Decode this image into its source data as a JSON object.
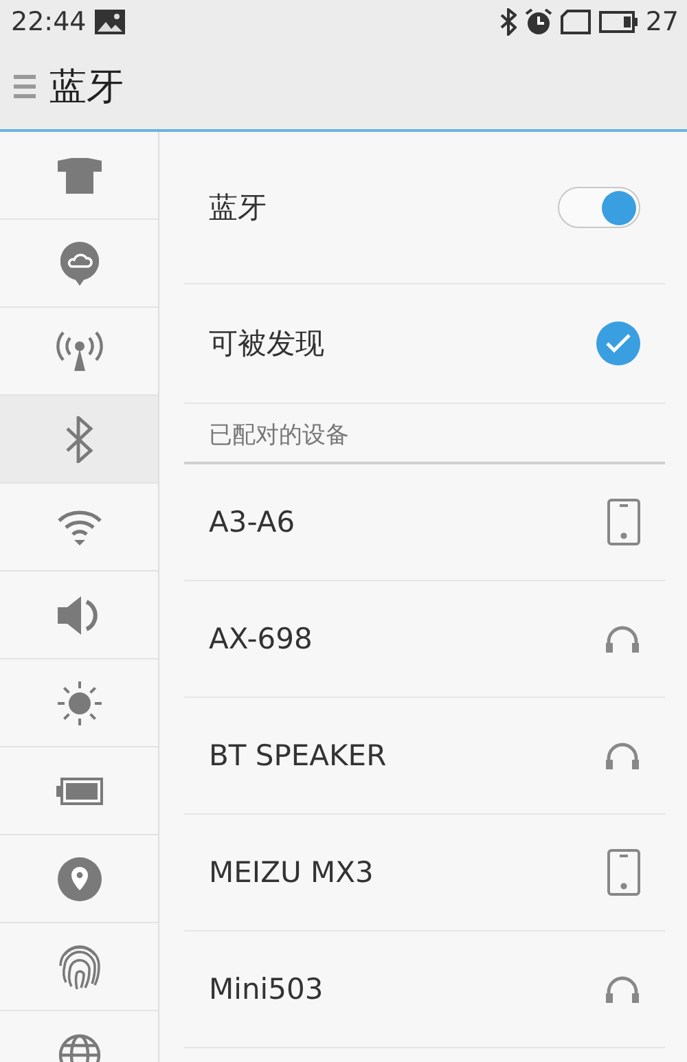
{
  "status_bar": {
    "time": "22:44",
    "battery": "27"
  },
  "header": {
    "title": "蓝牙"
  },
  "sidebar": {
    "items": [
      {
        "kind": "theme",
        "selected": false
      },
      {
        "kind": "cloud",
        "selected": false
      },
      {
        "kind": "hotspot",
        "selected": false
      },
      {
        "kind": "bluetooth",
        "selected": true
      },
      {
        "kind": "wifi",
        "selected": false
      },
      {
        "kind": "sound",
        "selected": false
      },
      {
        "kind": "brightness",
        "selected": false
      },
      {
        "kind": "battery",
        "selected": false
      },
      {
        "kind": "location",
        "selected": false
      },
      {
        "kind": "fingerprint",
        "selected": false
      },
      {
        "kind": "globe",
        "selected": false
      }
    ]
  },
  "settings": [
    {
      "kind": "toggle",
      "label": "蓝牙",
      "on": true
    },
    {
      "kind": "check",
      "label": "可被发现",
      "checked": true
    }
  ],
  "paired_section": {
    "title": "已配对的设备"
  },
  "devices": [
    {
      "name": "A3-A6",
      "kind": "phone"
    },
    {
      "name": "AX-698",
      "kind": "headphones"
    },
    {
      "name": "BT SPEAKER",
      "kind": "headphones"
    },
    {
      "name": "MEIZU MX3",
      "kind": "phone"
    },
    {
      "name": "Mini503",
      "kind": "headphones"
    }
  ]
}
